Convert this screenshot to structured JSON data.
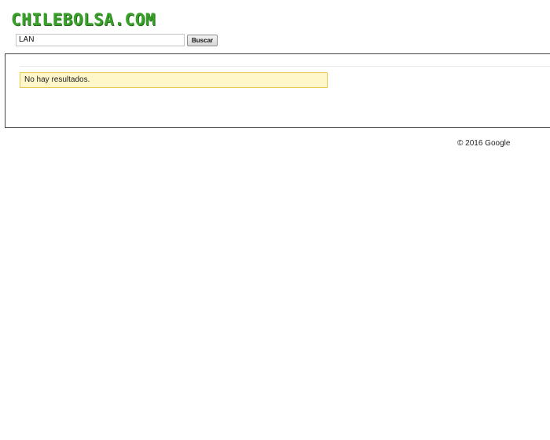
{
  "header": {
    "logo_text": "CHILEBOLSA.COM"
  },
  "search": {
    "value": "LAN",
    "button_label": "Buscar"
  },
  "results": {
    "message": "No hay resultados."
  },
  "footer": {
    "copyright": "© 2016 Google"
  },
  "colors": {
    "logo_green": "#3aa12b",
    "notice_background": "#fff6c9",
    "notice_border": "#e6c84e",
    "panel_border": "#444444"
  }
}
